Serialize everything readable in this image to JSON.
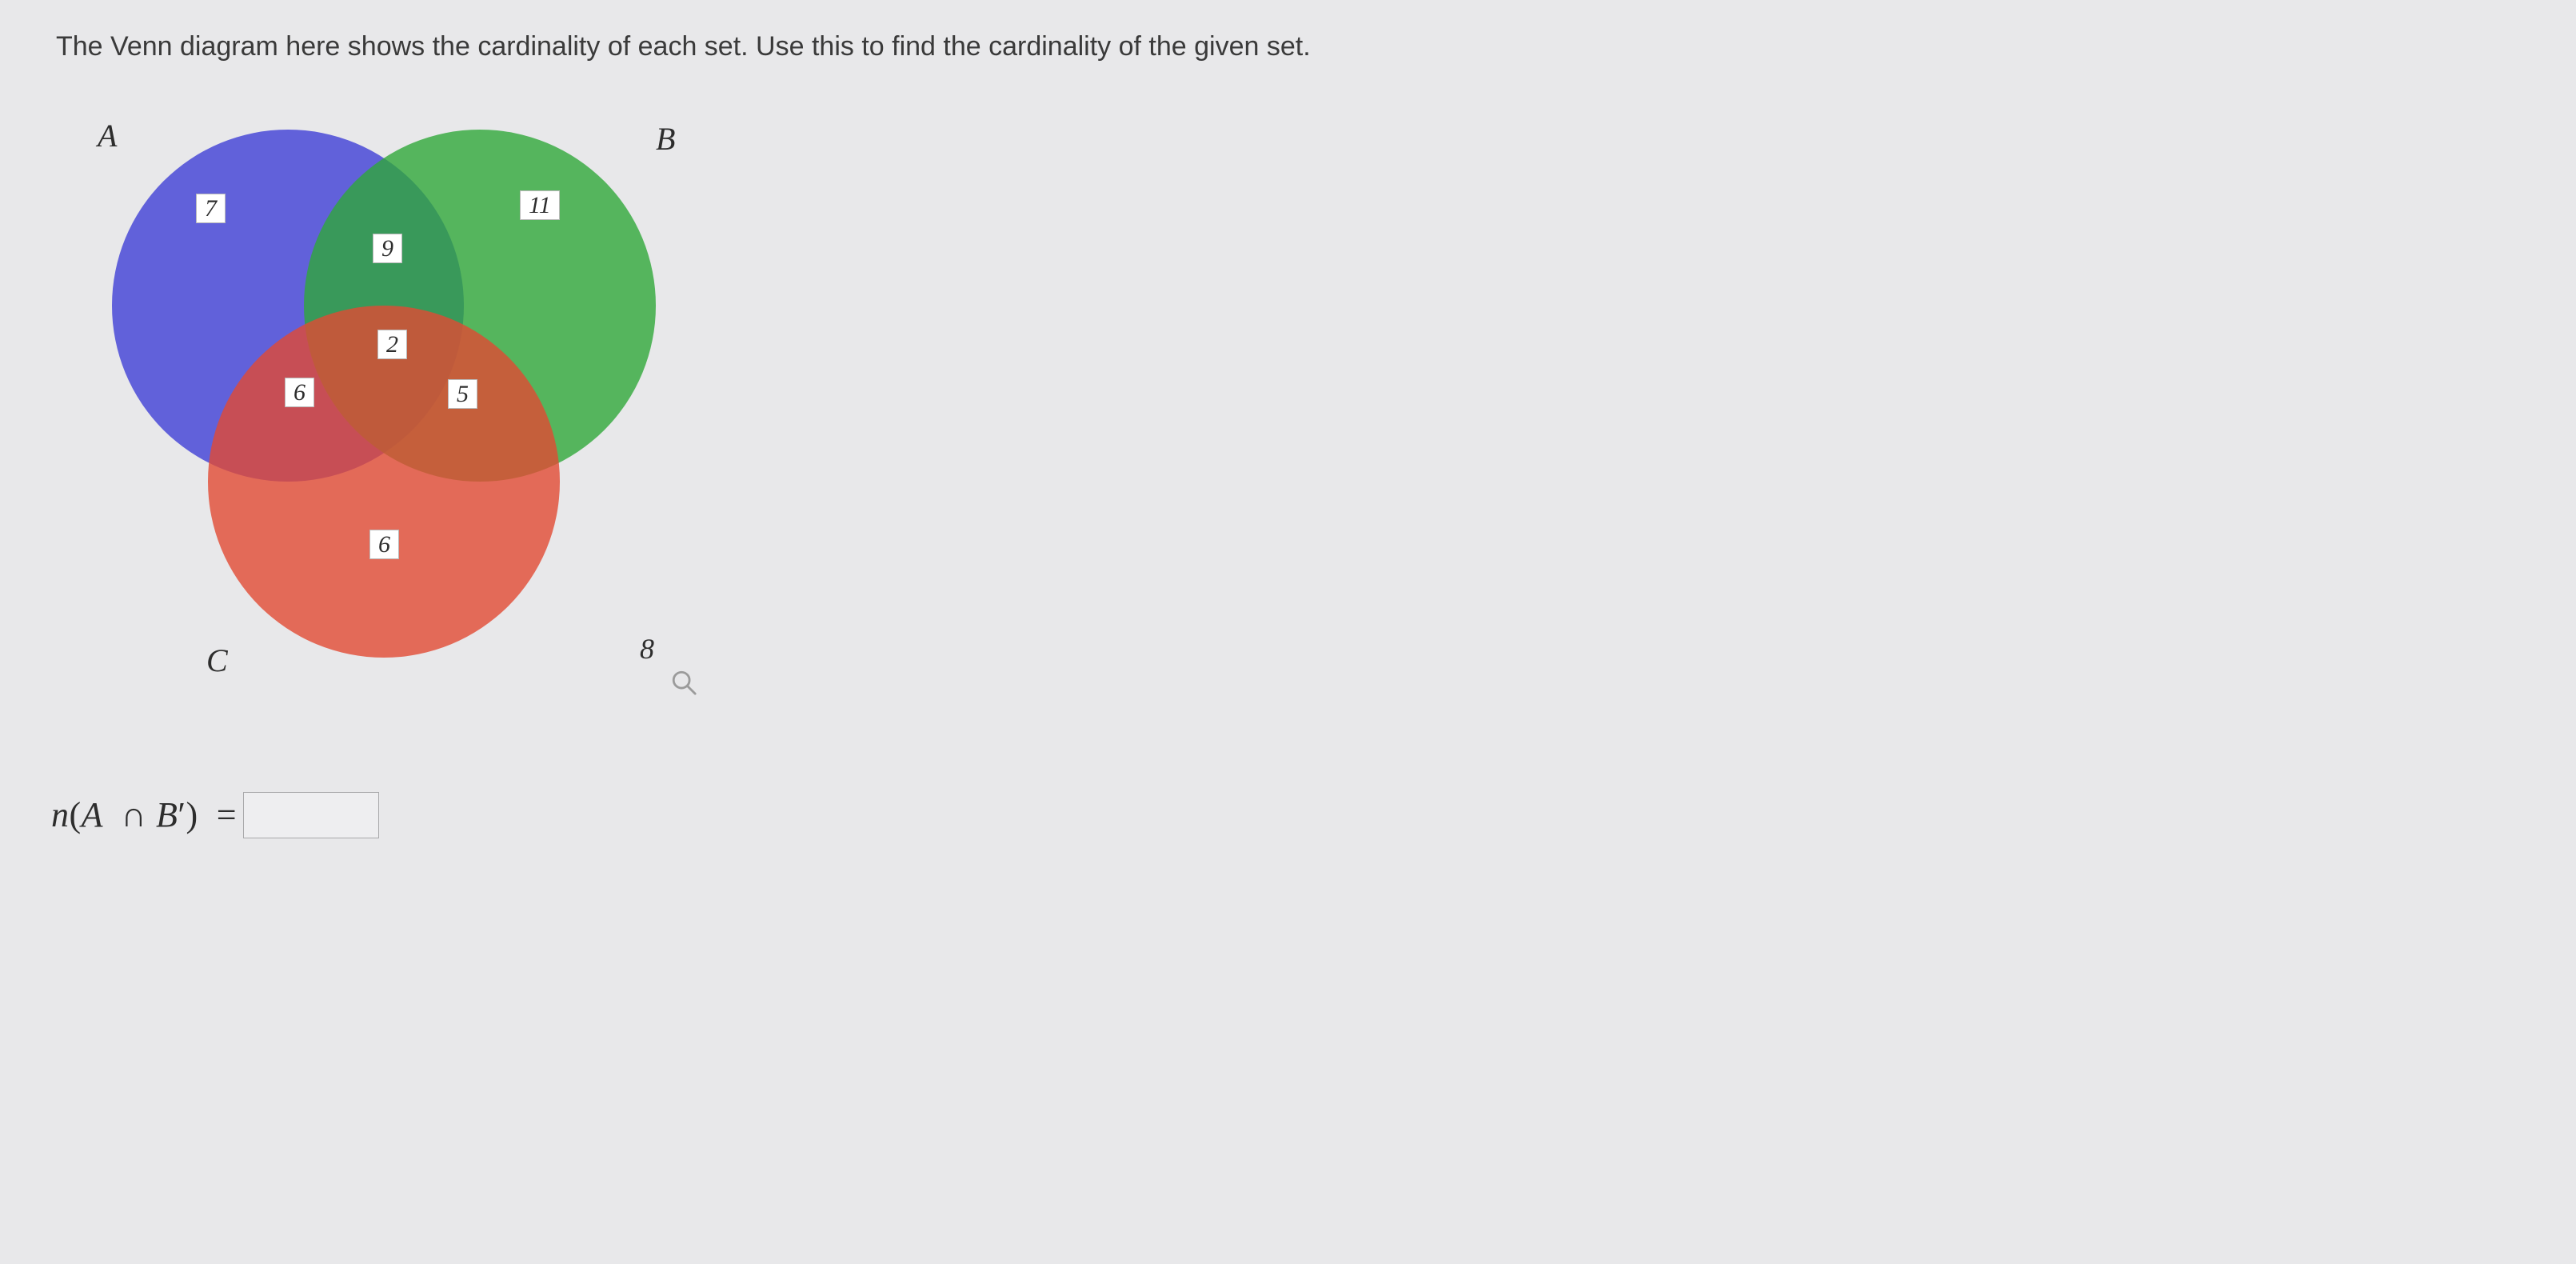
{
  "problem": {
    "prompt_text": "The Venn diagram here shows the cardinality of each set. Use this to find the cardinality of the given set.",
    "expression_html": "n(A ∩ B′) =",
    "answer_value": ""
  },
  "sets": {
    "A": {
      "label": "A",
      "color": "#3F3FD6"
    },
    "B": {
      "label": "B",
      "color": "#2FA83A"
    },
    "C": {
      "label": "C",
      "color": "#E14A33"
    }
  },
  "regions": {
    "A_only": 7,
    "B_only": 11,
    "C_only": 6,
    "A_and_B_only": 9,
    "A_and_C_only": 6,
    "B_and_C_only": 5,
    "A_and_B_and_C": 2,
    "outside": 8
  },
  "chart_data": {
    "type": "venn3",
    "sets": [
      "A",
      "B",
      "C"
    ],
    "region_counts": {
      "A_only": 7,
      "B_only": 11,
      "C_only": 6,
      "A∩B_only": 9,
      "A∩C_only": 6,
      "B∩C_only": 5,
      "A∩B∩C": 2,
      "outside_all": 8
    },
    "question": "n(A ∩ B′)",
    "colors": {
      "A": "#3F3FD6",
      "B": "#2FA83A",
      "C": "#E14A33"
    }
  }
}
